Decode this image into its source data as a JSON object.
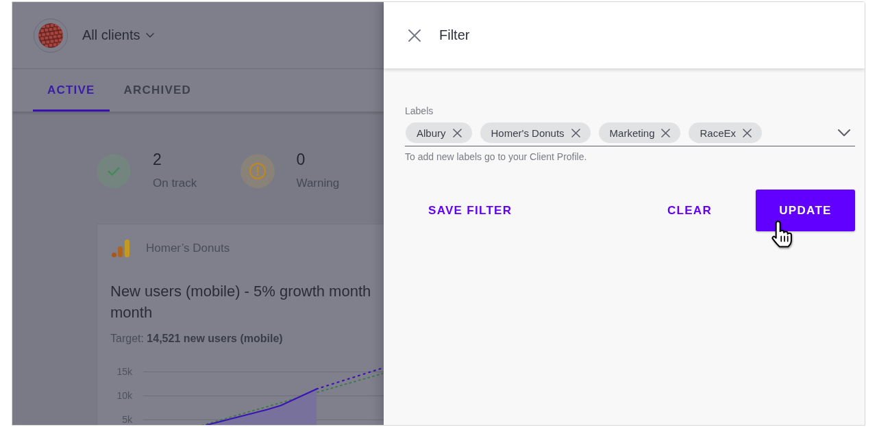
{
  "client_selector": {
    "label": "All clients"
  },
  "tabs": [
    {
      "label": "ACTIVE",
      "selected": true
    },
    {
      "label": "ARCHIVED",
      "selected": false
    }
  ],
  "stats": [
    {
      "kind": "on_track",
      "value": "2",
      "label": "On track"
    },
    {
      "kind": "warning",
      "value": "0",
      "label": "Warning"
    }
  ],
  "goal_card": {
    "source": "Homer’s Donuts",
    "title": "New users (mobile) - 5% growth month\nmonth",
    "target": "Target: **14,521 new users (mobile)**",
    "chart": {
      "y_axis_labels": [
        "15k",
        "10k",
        "5k"
      ]
    }
  },
  "filter_panel": {
    "title": "Filter",
    "labels_field": {
      "label": "Labels",
      "chips": [
        "Albury",
        "Homer's Donuts",
        "Marketing",
        "RaceEx"
      ],
      "helper": "To add new labels go to your Client Profile."
    },
    "buttons": [
      {
        "label": "SAVE FILTER",
        "kind": "text"
      },
      {
        "label": "CLEAR",
        "kind": "text"
      },
      {
        "label": "UPDATE",
        "kind": "primary"
      }
    ]
  }
}
